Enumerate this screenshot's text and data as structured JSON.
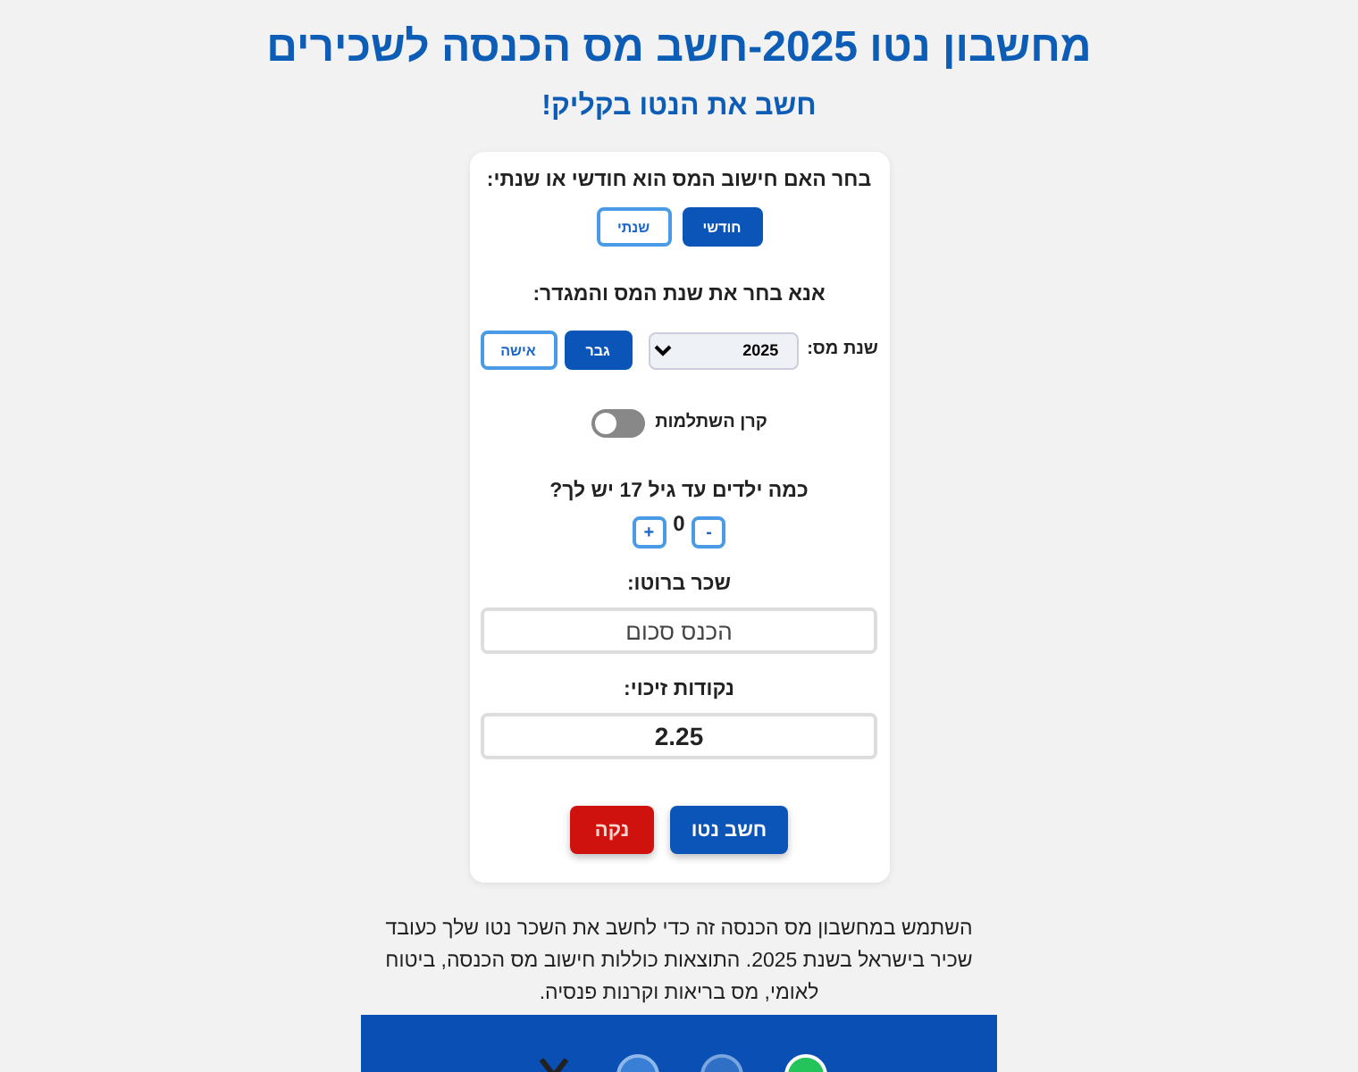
{
  "header": {
    "title": "מחשבון נטו 2025-חשב מס הכנסה לשכירים",
    "subtitle": "חשב את הנטו בקליק!"
  },
  "calculator": {
    "period_label": "בחר האם חישוב המס הוא חודשי או שנתי:",
    "period_options": [
      {
        "label": "חודשי",
        "selected": true
      },
      {
        "label": "שנתי",
        "selected": false
      }
    ],
    "year_gender_label": "אנא בחר את שנת המס והמגדר:",
    "tax_year": {
      "label": "שנת מס:",
      "value": "2025"
    },
    "gender_options": [
      {
        "label": "גבר",
        "selected": true
      },
      {
        "label": "אישה",
        "selected": false
      }
    ],
    "study_fund_toggle": {
      "label": "קרן השתלמות",
      "on": false
    },
    "children": {
      "label": "כמה ילדים עד גיל 17 יש לך?",
      "decrement": "-",
      "count": "0",
      "increment": "+"
    },
    "gross_salary": {
      "label": "שכר ברוטו:",
      "placeholder": "הכנס סכום"
    },
    "credit_points": {
      "label": "נקודות זיכוי:",
      "value": "2.25"
    },
    "buttons": [
      {
        "label": "חשב נטו",
        "kind": "primary"
      },
      {
        "label": "נקה",
        "kind": "danger"
      }
    ]
  },
  "description": "השתמש במחשבון מס הכנסה זה כדי לחשב את השכר נטו שלך כעובד שכיר בישראל בשנת 2025. התוצאות כוללות חישוב מס הכנסה, ביטוח לאומי, מס בריאות וקרנות פנסיה."
}
